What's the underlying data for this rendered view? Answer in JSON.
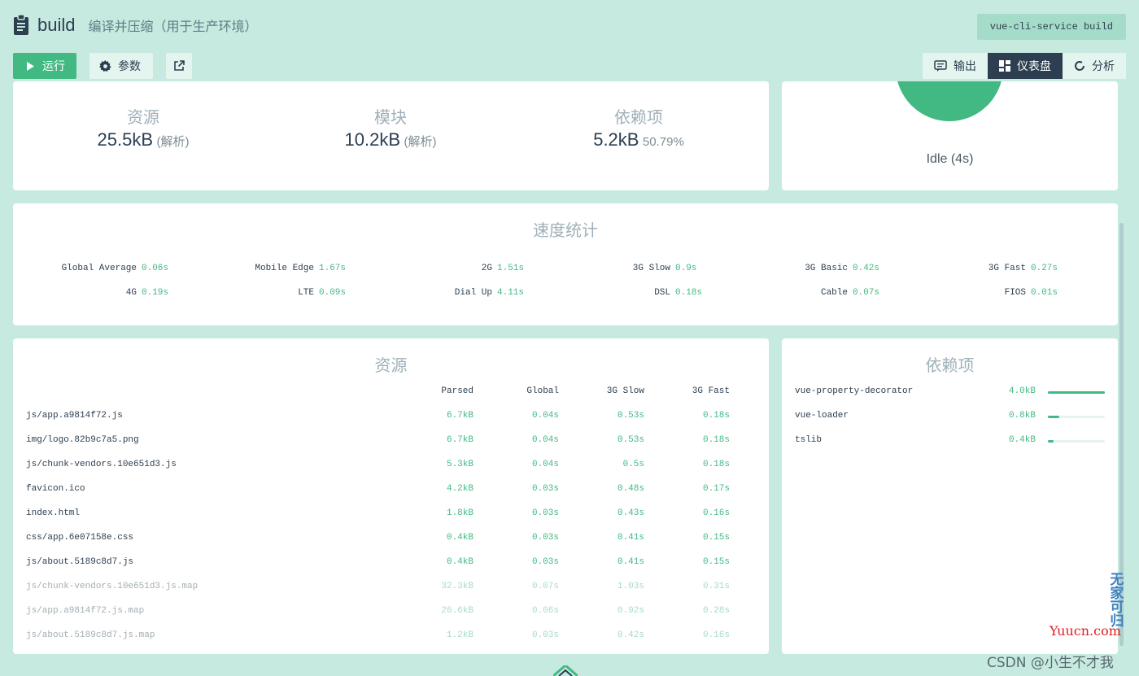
{
  "header": {
    "task_name": "build",
    "task_description": "编译并压缩（用于生产环境）",
    "command": "vue-cli-service build",
    "run_label": "运行",
    "params_label": "参数",
    "tabs": [
      {
        "label": "输出",
        "icon": "message-icon",
        "active": false
      },
      {
        "label": "仪表盘",
        "icon": "dashboard-icon",
        "active": true
      },
      {
        "label": "分析",
        "icon": "refresh-icon",
        "active": false
      }
    ]
  },
  "stats": [
    {
      "label": "资源",
      "value": "25.5kB",
      "sub": "(解析)"
    },
    {
      "label": "模块",
      "value": "10.2kB",
      "sub": "(解析)"
    },
    {
      "label": "依赖项",
      "value": "5.2kB",
      "sub": "50.79%"
    }
  ],
  "status": {
    "label": "Idle (4s)"
  },
  "speed": {
    "title": "速度统计",
    "items": [
      {
        "name": "Global Average",
        "value": "0.06s"
      },
      {
        "name": "Mobile Edge",
        "value": "1.67s"
      },
      {
        "name": "2G",
        "value": "1.51s"
      },
      {
        "name": "3G Slow",
        "value": "0.9s"
      },
      {
        "name": "3G Basic",
        "value": "0.42s"
      },
      {
        "name": "3G Fast",
        "value": "0.27s"
      },
      {
        "name": "4G",
        "value": "0.19s"
      },
      {
        "name": "LTE",
        "value": "0.09s"
      },
      {
        "name": "Dial Up",
        "value": "4.11s"
      },
      {
        "name": "DSL",
        "value": "0.18s"
      },
      {
        "name": "Cable",
        "value": "0.07s"
      },
      {
        "name": "FIOS",
        "value": "0.01s"
      }
    ]
  },
  "assets": {
    "title": "资源",
    "columns": [
      "Parsed",
      "Global",
      "3G Slow",
      "3G Fast"
    ],
    "rows": [
      {
        "name": "js/app.a9814f72.js",
        "parsed": "6.7kB",
        "global": "0.04s",
        "slow": "0.53s",
        "fast": "0.18s",
        "faded": false
      },
      {
        "name": "img/logo.82b9c7a5.png",
        "parsed": "6.7kB",
        "global": "0.04s",
        "slow": "0.53s",
        "fast": "0.18s",
        "faded": false
      },
      {
        "name": "js/chunk-vendors.10e651d3.js",
        "parsed": "5.3kB",
        "global": "0.04s",
        "slow": "0.5s",
        "fast": "0.18s",
        "faded": false
      },
      {
        "name": "favicon.ico",
        "parsed": "4.2kB",
        "global": "0.03s",
        "slow": "0.48s",
        "fast": "0.17s",
        "faded": false
      },
      {
        "name": "index.html",
        "parsed": "1.8kB",
        "global": "0.03s",
        "slow": "0.43s",
        "fast": "0.16s",
        "faded": false
      },
      {
        "name": "css/app.6e07158e.css",
        "parsed": "0.4kB",
        "global": "0.03s",
        "slow": "0.41s",
        "fast": "0.15s",
        "faded": false
      },
      {
        "name": "js/about.5189c8d7.js",
        "parsed": "0.4kB",
        "global": "0.03s",
        "slow": "0.41s",
        "fast": "0.15s",
        "faded": false
      },
      {
        "name": "js/chunk-vendors.10e651d3.js.map",
        "parsed": "32.3kB",
        "global": "0.07s",
        "slow": "1.03s",
        "fast": "0.31s",
        "faded": true
      },
      {
        "name": "js/app.a9814f72.js.map",
        "parsed": "26.6kB",
        "global": "0.06s",
        "slow": "0.92s",
        "fast": "0.28s",
        "faded": true
      },
      {
        "name": "js/about.5189c8d7.js.map",
        "parsed": "1.2kB",
        "global": "0.03s",
        "slow": "0.42s",
        "fast": "0.16s",
        "faded": true
      }
    ]
  },
  "dependencies": {
    "title": "依赖项",
    "items": [
      {
        "name": "vue-property-decorator",
        "size": "4.0kB",
        "ratio": 1.0
      },
      {
        "name": "vue-loader",
        "size": "0.8kB",
        "ratio": 0.2
      },
      {
        "name": "tslib",
        "size": "0.4kB",
        "ratio": 0.1
      }
    ]
  },
  "watermarks": {
    "vertical": "无家可归",
    "site": "Yuucn.com",
    "csdn": "CSDN @小生不才我"
  },
  "colors": {
    "background": "#c6eadf",
    "accent": "#42b983",
    "dark": "#2c3e50",
    "muted": "#9fb1b9"
  }
}
